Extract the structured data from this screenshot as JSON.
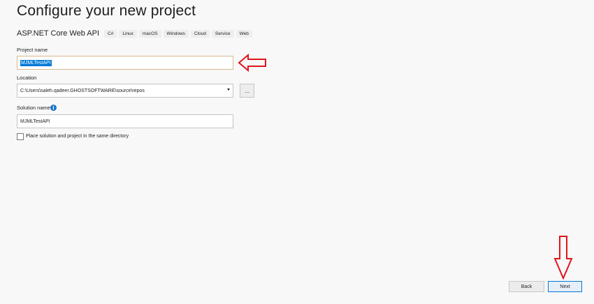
{
  "page": {
    "title": "Configure your new project"
  },
  "template": {
    "name": "ASP.NET Core Web API",
    "tags": [
      "C#",
      "Linux",
      "macOS",
      "Windows",
      "Cloud",
      "Service",
      "Web"
    ]
  },
  "project_name": {
    "label": "Project name",
    "value": "MJMLTestAPI"
  },
  "location": {
    "label": "Location",
    "value": "C:\\Users\\saleh.qadeer.GHOSTSOFTWARE\\source\\repos",
    "browse_label": "..."
  },
  "solution_name": {
    "label": "Solution name",
    "value": "MJMLTestAPI",
    "info_icon": "info-icon"
  },
  "same_directory": {
    "label": "Place solution and project in the same directory",
    "checked": false
  },
  "footer": {
    "back_label": "Back",
    "next_label": "Next"
  },
  "colors": {
    "accent": "#0078d7",
    "annotation_arrow": "#e0141e",
    "info": "#1a73c8"
  }
}
